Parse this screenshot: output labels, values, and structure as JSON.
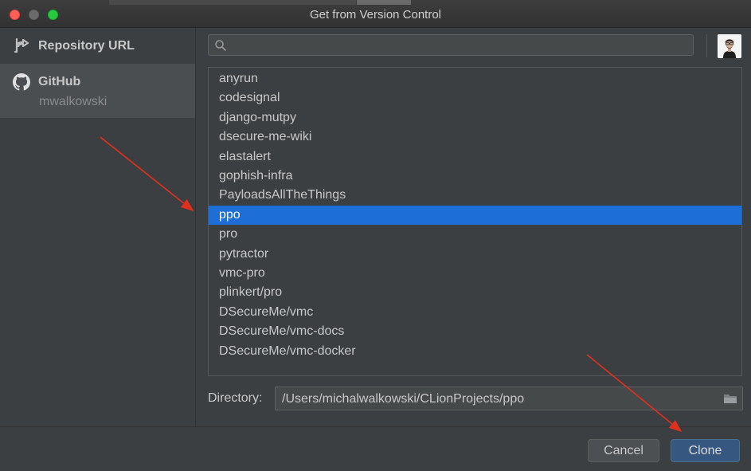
{
  "window": {
    "title": "Get from Version Control"
  },
  "sidebar": {
    "items": [
      {
        "label": "Repository URL",
        "icon": "vcs-icon"
      },
      {
        "label": "GitHub",
        "sub": "mwalkowski",
        "icon": "github-icon"
      }
    ]
  },
  "search": {
    "value": "",
    "placeholder": ""
  },
  "repos": [
    "anyrun",
    "codesignal",
    "django-mutpy",
    "dsecure-me-wiki",
    "elastalert",
    "gophish-infra",
    "PayloadsAllTheThings",
    "ppo",
    "pro",
    "pytractor",
    "vmc-pro",
    "plinkert/pro",
    "DSecureMe/vmc",
    "DSecureMe/vmc-docs",
    "DSecureMe/vmc-docker"
  ],
  "selected_repo": "ppo",
  "directory": {
    "label": "Directory:",
    "value": "/Users/michalwalkowski/CLionProjects/ppo"
  },
  "buttons": {
    "cancel": "Cancel",
    "clone": "Clone"
  },
  "colors": {
    "selection": "#1d6ed6",
    "annotation_arrow": "#e0301e",
    "primary_button": "#365880"
  }
}
